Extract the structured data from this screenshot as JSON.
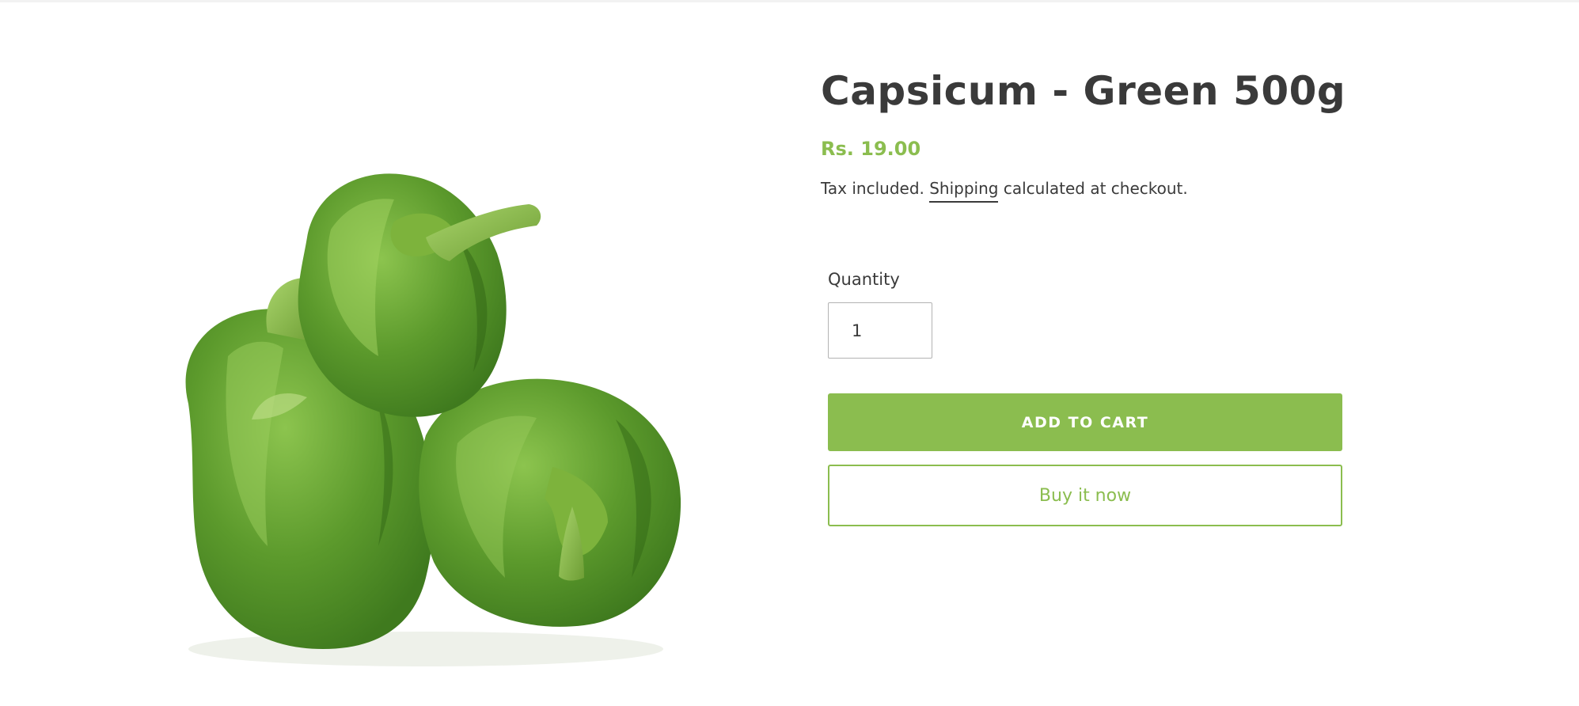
{
  "product": {
    "title": "Capsicum - Green 500g",
    "price": "Rs. 19.00",
    "tax_note_prefix": "Tax included. ",
    "shipping_link": "Shipping",
    "tax_note_suffix": " calculated at checkout.",
    "image_icon": "green-capsicum-photo"
  },
  "form": {
    "quantity_label": "Quantity",
    "quantity_value": "1",
    "add_to_cart_label": "ADD TO CART",
    "buy_now_label": "Buy it now"
  },
  "colors": {
    "accent": "#8bbd4f",
    "text": "#3a3a3a",
    "pepper_dark": "#3f7a1e",
    "pepper_mid": "#5c9a2c",
    "pepper_light": "#8cc44e"
  }
}
